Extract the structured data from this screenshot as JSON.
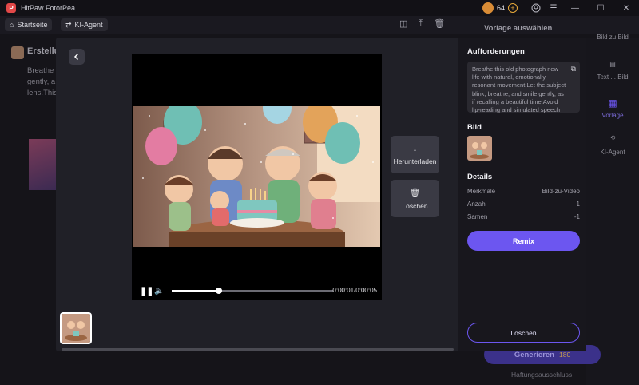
{
  "titlebar": {
    "app_title": "HitPaw FotorPea",
    "credits": "64",
    "plus": "+"
  },
  "nav": {
    "home_label": "Startseite",
    "agent_label": "KI-Agent"
  },
  "background": {
    "heading": "Erstellu",
    "paragraph": "Breathe gently, a lens.This",
    "template_title": "Vorlage auswählen",
    "side_items": [
      "Bild zu Bild",
      "Text ... Bild",
      "Vorlage",
      "KI-Agent"
    ],
    "generate_label": "Generieren",
    "generate_credits": "180",
    "disclaimer": "Haftungsausschluss"
  },
  "player": {
    "time": "0:00:01/0:00:05",
    "progress_fraction": 0.29
  },
  "actions": {
    "download_label": "Herunterladen",
    "delete_label": "Löschen"
  },
  "panel": {
    "prompt_title": "Aufforderungen",
    "prompt_text": "Breathe this old photograph new life with natural, emotionally resonant movement.Let the subject blink, breathe, and smile gently, as if recalling a beautiful time.Avoid lip-reading and simulated speech",
    "image_title": "Bild",
    "details_title": "Details",
    "details": [
      {
        "label": "Merkmale",
        "value": "Bild-zu-Video"
      },
      {
        "label": "Anzahl",
        "value": "1"
      },
      {
        "label": "Samen",
        "value": "-1"
      }
    ],
    "remix_label": "Remix",
    "delete_label": "Löschen"
  },
  "colors": {
    "accent": "#6c56f0",
    "background": "#151419",
    "modal": "#202027"
  }
}
